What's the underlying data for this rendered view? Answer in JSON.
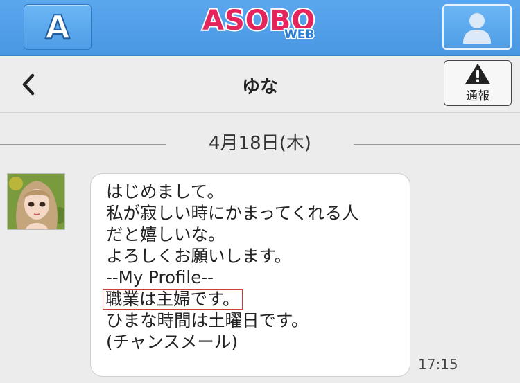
{
  "appbar": {
    "left_button_letter": "A",
    "logo_main": "ASOBO",
    "logo_sub": "WEB",
    "right_button_icon": "user-icon"
  },
  "header": {
    "title": "ゆな",
    "back_icon": "chevron-left-icon",
    "report_icon": "warning-icon",
    "report_label": "通報"
  },
  "chat": {
    "date": "4月18日(木)",
    "message": {
      "lines": [
        "はじめまして。",
        "私が寂しい時にかまってくれる人",
        "だと嬉しいな。",
        "よろしくお願いします。",
        "--My Profile--",
        "職業は主婦です。",
        "ひまな時間は土曜日です。",
        "(チャンスメール)"
      ],
      "time": "17:15"
    }
  },
  "colors": {
    "appbar_blue": "#4a97e2",
    "logo_pink": "#e4245b",
    "highlight_red": "#c9403c",
    "background": "#ececec"
  }
}
